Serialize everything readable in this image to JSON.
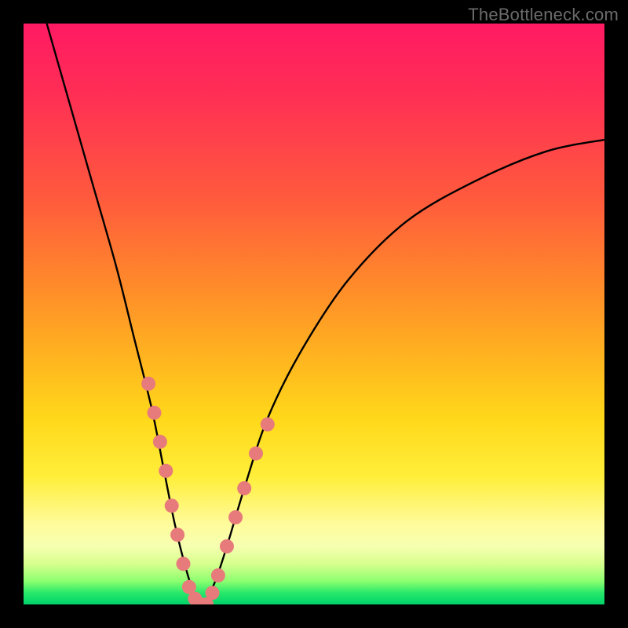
{
  "watermark": "TheBottleneck.com",
  "chart_data": {
    "type": "line",
    "title": "",
    "xlabel": "",
    "ylabel": "",
    "xlim": [
      0,
      100
    ],
    "ylim": [
      0,
      100
    ],
    "grid": false,
    "legend": false,
    "description": "V-shaped bottleneck curve over a vertical red→green gradient background. The curve's trough sits near the bottom-left third of the plot; the value rises steeply to both sides, with a gentler slope to the right. Pink marker dots annotate the lower flanks of the V near the trough.",
    "series": [
      {
        "name": "bottleneck-curve",
        "color": "#000000",
        "x": [
          4,
          8,
          12,
          16,
          19,
          22,
          24,
          26,
          28,
          30,
          31,
          33,
          35,
          38,
          42,
          48,
          56,
          66,
          78,
          90,
          100
        ],
        "y": [
          100,
          86,
          72,
          58,
          46,
          34,
          24,
          14,
          6,
          0,
          0,
          4,
          10,
          20,
          32,
          44,
          56,
          66,
          73,
          78,
          80
        ]
      }
    ],
    "markers": [
      {
        "x": 21.5,
        "y": 38
      },
      {
        "x": 22.5,
        "y": 33
      },
      {
        "x": 23.5,
        "y": 28
      },
      {
        "x": 24.5,
        "y": 23
      },
      {
        "x": 25.5,
        "y": 17
      },
      {
        "x": 26.5,
        "y": 12
      },
      {
        "x": 27.5,
        "y": 7
      },
      {
        "x": 28.5,
        "y": 3
      },
      {
        "x": 29.5,
        "y": 1
      },
      {
        "x": 30.5,
        "y": 0
      },
      {
        "x": 31.5,
        "y": 0
      },
      {
        "x": 32.5,
        "y": 2
      },
      {
        "x": 33.5,
        "y": 5
      },
      {
        "x": 35.0,
        "y": 10
      },
      {
        "x": 36.5,
        "y": 15
      },
      {
        "x": 38.0,
        "y": 20
      },
      {
        "x": 40.0,
        "y": 26
      },
      {
        "x": 42.0,
        "y": 31
      }
    ],
    "marker_style": {
      "fill": "#e77b7b",
      "r": 9
    },
    "gradient_stops": [
      {
        "pos": 0,
        "color": "#ff1a63"
      },
      {
        "pos": 30,
        "color": "#ff5a3d"
      },
      {
        "pos": 60,
        "color": "#ffc81a"
      },
      {
        "pos": 85,
        "color": "#fffb9a"
      },
      {
        "pos": 100,
        "color": "#00d36a"
      }
    ]
  }
}
